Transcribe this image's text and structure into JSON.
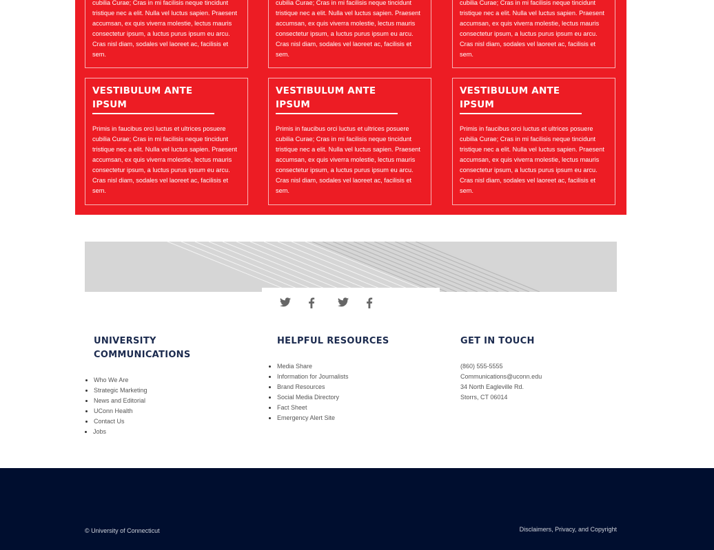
{
  "cards_top": [
    {
      "body": "cubilia Curae; Cras in mi facilisis neque tincidunt tristique nec a elit. Nulla vel luctus sapien. Praesent accumsan, ex quis viverra molestie, lectus mauris consectetur ipsum, a luctus purus ipsum eu arcu. Cras nisl diam, sodales vel laoreet ac, facilisis et sem."
    },
    {
      "body": "cubilia Curae; Cras in mi facilisis neque tincidunt tristique nec a elit. Nulla vel luctus sapien. Praesent accumsan, ex quis viverra molestie, lectus mauris consectetur ipsum, a luctus purus ipsum eu arcu. Cras nisl diam, sodales vel laoreet ac, facilisis et sem."
    },
    {
      "body": "cubilia Curae; Cras in mi facilisis neque tincidunt tristique nec a elit. Nulla vel luctus sapien. Praesent accumsan, ex quis viverra molestie, lectus mauris consectetur ipsum, a luctus purus ipsum eu arcu. Cras nisl diam, sodales vel laoreet ac, facilisis et sem."
    }
  ],
  "cards_bottom": [
    {
      "title": "Vestibulum ante ipsum",
      "body": "Primis in faucibus orci luctus et ultrices posuere cubilia Curae; Cras in mi facilisis neque tincidunt tristique nec a elit. Nulla vel luctus sapien. Praesent accumsan, ex quis viverra molestie, lectus mauris consectetur ipsum, a luctus purus ipsum eu arcu. Cras nisl diam, sodales vel laoreet ac, facilisis et sem."
    },
    {
      "title": "Vestibulum ante ipsum",
      "body": "Primis in faucibus orci luctus et ultrices posuere cubilia Curae; Cras in mi facilisis neque tincidunt tristique nec a elit. Nulla vel luctus sapien. Praesent accumsan, ex quis viverra molestie, lectus mauris consectetur ipsum, a luctus purus ipsum eu arcu. Cras nisl diam, sodales vel laoreet ac, facilisis et sem."
    },
    {
      "title": "Vestibulum ante ipsum",
      "body": "Primis in faucibus orci luctus et ultrices posuere cubilia Curae; Cras in mi facilisis neque tincidunt tristique nec a elit. Nulla vel luctus sapien. Praesent accumsan, ex quis viverra molestie, lectus mauris consectetur ipsum, a luctus purus ipsum eu arcu. Cras nisl diam, sodales vel laoreet ac, facilisis et sem."
    }
  ],
  "social": {
    "icons": [
      "twitter-icon",
      "facebook-icon",
      "twitter-icon",
      "facebook-icon"
    ],
    "glyphs": {
      "twitter": "🐦",
      "facebook": "f"
    }
  },
  "footer": {
    "col1": {
      "title": "University Communications",
      "links": [
        "Who We Are",
        "Strategic Marketing",
        "News and Editorial",
        "UConn Health",
        "Contact Us",
        "Jobs"
      ]
    },
    "col2": {
      "title": "Helpful Resources",
      "links": [
        "Media Share",
        "Information for Journalists",
        "Brand Resources",
        "Social Media Directory",
        "Fact Sheet",
        "Emergency Alert Site"
      ]
    },
    "col3": {
      "title": "Get in Touch",
      "phone": "(860) 555-5555",
      "email": "Communications@uconn.edu",
      "address1": "34 North Eagleville Rd.",
      "address2": "Storrs, CT 06014"
    }
  },
  "bottom": {
    "copyright": "© University of Connecticut",
    "legal": "Disclaimers, Privacy, and Copyright"
  },
  "colors": {
    "accent_red": "#ed1c24",
    "navy": "#000e2f",
    "heading_navy": "#1b2a4e"
  }
}
